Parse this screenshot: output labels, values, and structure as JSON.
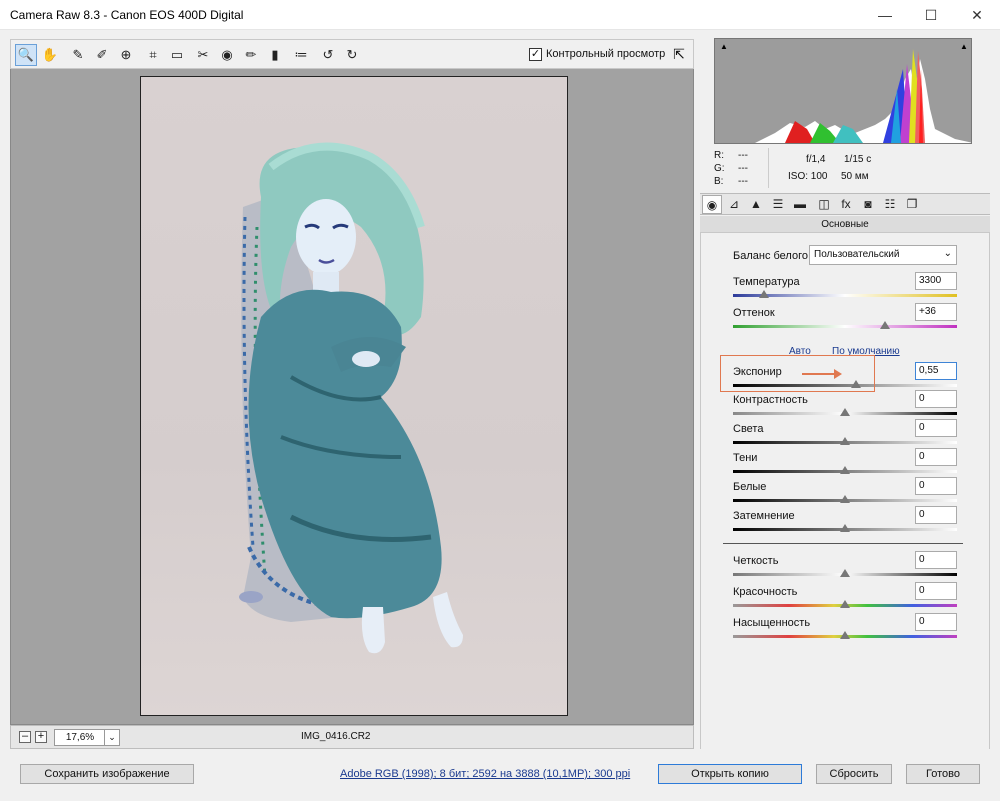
{
  "window": {
    "title": "Camera Raw 8.3  -  Canon EOS 400D Digital",
    "min_glyph": "—",
    "max_glyph": "☐",
    "close_glyph": "✕"
  },
  "toolbar": {
    "tools": [
      {
        "name": "zoom-tool",
        "glyph": "🔍"
      },
      {
        "name": "hand-tool",
        "glyph": "✋"
      },
      {
        "name": "white-balance-tool",
        "glyph": "✎"
      },
      {
        "name": "color-sampler-tool",
        "glyph": "✐"
      },
      {
        "name": "targeted-adjustment-tool",
        "glyph": "⊕"
      },
      {
        "name": "crop-tool",
        "glyph": "⌗"
      },
      {
        "name": "straighten-tool",
        "glyph": "▭"
      },
      {
        "name": "spot-removal-tool",
        "glyph": "✂"
      },
      {
        "name": "red-eye-tool",
        "glyph": "◉"
      },
      {
        "name": "adjustment-brush-tool",
        "glyph": "✏"
      },
      {
        "name": "graduated-filter-tool",
        "glyph": "▮"
      },
      {
        "name": "radial-filter-tool",
        "glyph": "≔"
      },
      {
        "name": "rotate-left-tool",
        "glyph": "↺"
      },
      {
        "name": "rotate-right-tool",
        "glyph": "↻"
      }
    ],
    "preview_label": "Контрольный просмотр",
    "preview_checked": "✓",
    "fullscreen_glyph": "⇱"
  },
  "status": {
    "zoom_out": "–",
    "zoom_in": "+",
    "zoom_value": "17,6%",
    "zoom_arrow": "⌄",
    "filename": "IMG_0416.CR2"
  },
  "readout": {
    "r_label": "R:",
    "g_label": "G:",
    "b_label": "B:",
    "r_value": "---",
    "g_value": "---",
    "b_value": "---",
    "aperture": "f/1,4",
    "shutter": "1/15 с",
    "iso": "ISO: 100",
    "focal": "50 мм"
  },
  "panel": {
    "title": "Основные",
    "tabs": [
      "◉",
      "⊿",
      "▲",
      "☰",
      "▬",
      "◫",
      "fx",
      "◙",
      "☷",
      "❐"
    ],
    "wb_label": "Баланс белого:",
    "wb_value": "Пользовательский",
    "wb_arrow": "⌄",
    "auto_link": "Авто",
    "default_link": "По умолчанию",
    "sliders": [
      {
        "label": "Температура",
        "value": "3300",
        "position": 0.14
      },
      {
        "label": "Оттенок",
        "value": "+36",
        "position": 0.68
      },
      {
        "label": "Экспонир",
        "value": "0,55",
        "position": 0.55
      },
      {
        "label": "Контрастность",
        "value": "0",
        "position": 0.5
      },
      {
        "label": "Света",
        "value": "0",
        "position": 0.5
      },
      {
        "label": "Тени",
        "value": "0",
        "position": 0.5
      },
      {
        "label": "Белые",
        "value": "0",
        "position": 0.5
      },
      {
        "label": "Затемнение",
        "value": "0",
        "position": 0.5
      },
      {
        "label": "Четкость",
        "value": "0",
        "position": 0.5
      },
      {
        "label": "Красочность",
        "value": "0",
        "position": 0.5
      },
      {
        "label": "Насыщенность",
        "value": "0",
        "position": 0.5
      }
    ]
  },
  "footer": {
    "save_label": "Сохранить изображение",
    "info_link": "Adobe RGB (1998); 8 бит; 2592 на 3888 (10,1МР); 300 ppi",
    "open_label": "Открыть копию",
    "reset_label": "Сбросить",
    "done_label": "Готово"
  },
  "colors": {
    "accent": "#2d7bd8",
    "highlight": "#e07850"
  }
}
